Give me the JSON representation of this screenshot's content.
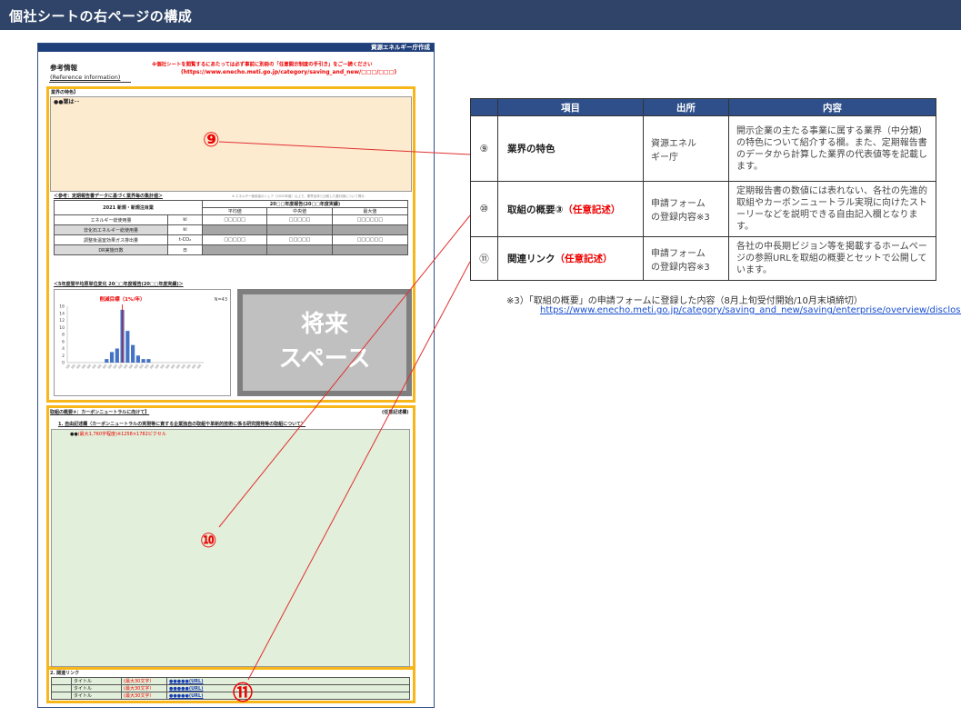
{
  "header": {
    "title": "個社シートの右ページの構成"
  },
  "sheet": {
    "top_label": "資源エネルギー庁作成",
    "ref_title": "参考情報",
    "ref_sub": "(Reference information)",
    "notice_1": "※個社シートを閲覧するにあたっては必ず事前に別冊の「任意開示制度の手引き」をご一読ください",
    "notice_2": "(https://www.enecho.meti.go.jp/category/saving_and_new/□□□/□□□)",
    "industry_title": "業界の特色】",
    "industry_text": "●●業は･･",
    "marker_9": "⑨",
    "mt_heading": "＜参考：定期報告書データに基づく業界毎の集計値＞",
    "mt_note": "※ エネルギー使用量のシェア（2020年度）以上で、業界全体と比較した集計値について掲示",
    "mt_period": "20□□年度報告(20□□年度実績)",
    "mt_head_left": "2021 新規・新規注目業",
    "mt_cols": [
      "平均値",
      "中央値",
      "最大値"
    ],
    "mt_rows": [
      {
        "label": "エネルギー総使用量",
        "unit": "kl",
        "v": [
          "□□□□□",
          "□□□□□",
          "□□□□□□"
        ]
      },
      {
        "label": "非化石エネルギー総使用量",
        "unit": "kl",
        "v": [
          "",
          "",
          ""
        ]
      },
      {
        "label": "調整後温室効果ガス排出量",
        "unit": "t-CO₂",
        "v": [
          "□□□□□",
          "□□□□□",
          "□□□□□□"
        ]
      },
      {
        "label": "DR実施日数",
        "unit": "日",
        "v": [
          "",
          "",
          ""
        ]
      }
    ],
    "hist_heading": "＜5年度間平均原単位変化 20□□年度報告(20□□年度実績)＞",
    "hist_target": "削減目標（1%/年）",
    "hist_n": "N=43",
    "future_space": [
      "将来",
      "スペース"
    ],
    "overview_title": "取組の概要③：カーボンニュートラルに向けて】",
    "overview_optional": "(任意記述欄)",
    "free_title": "1. 自由記述欄（カーボンニュートラルの実現等に資する企業独自の取組や革新的技術に係る研究開発等の取組について）",
    "free_text_a": "●●",
    "free_text_b": "(最大1,760字程度)※1258×1782ピクセル",
    "marker_10": "⑩",
    "links_title": "2. 関連リンク",
    "links": [
      {
        "title": "タイトル",
        "limit": "(最大30文字）",
        "url": "●●●●●(URL)"
      },
      {
        "title": "タイトル",
        "limit": "(最大30文字）",
        "url": "●●●●●(URL)"
      },
      {
        "title": "タイトル",
        "limit": "(最大30文字）",
        "url": "●●●●●(URL)"
      }
    ],
    "marker_11": "⑪"
  },
  "table": {
    "headers": [
      "",
      "項目",
      "出所",
      "内容"
    ],
    "rows": [
      {
        "num": "⑨",
        "item": "業界の特色",
        "optional": "",
        "source": "資源エネル\nギー庁",
        "content": "開示企業の主たる事業に属する業界（中分類）の特色について紹介する欄。また、定期報告書のデータから計算した業界の代表値等を記載します。"
      },
      {
        "num": "⑩",
        "item": "取組の概要③",
        "optional": "（任意記述）",
        "source": "申請フォーム\nの登録内容※3",
        "content": "定期報告書の数値には表れない、各社の先進的取組やカーボンニュートラル実現に向けたストーリーなどを説明できる自由記入欄となります。"
      },
      {
        "num": "⑪",
        "item": "関連リンク",
        "optional": "（任意記述）",
        "source": "申請フォーム\nの登録内容※3",
        "content": "各社の中長期ビジョン等を掲載するホームページの参照URLを取組の概要とセットで公開しています。"
      }
    ]
  },
  "footnote": {
    "text": "※3）「取組の概要」の申請フォームに登録した内容（8月上旬受付開始/10月末頃締切）",
    "link": "https://www.enecho.meti.go.jp/category/saving_and_new/saving/enterprise/overview/disclosure/"
  },
  "chart_data": {
    "type": "bar",
    "title": "",
    "xlabel": "",
    "ylabel": "",
    "ylim": [
      0,
      16
    ],
    "y_ticks": [
      0,
      2,
      4,
      6,
      8,
      10,
      12,
      14,
      16
    ],
    "values": [
      0,
      0,
      0,
      0,
      0,
      0,
      0,
      1,
      3,
      4,
      15,
      9,
      5,
      2,
      1,
      1,
      0,
      0,
      0,
      0,
      0,
      0,
      0,
      0,
      0,
      0
    ],
    "target_line_index": 10.5,
    "annotation": "削減目標（1%/年）",
    "n_label": "N=43",
    "color": "#4472c4"
  }
}
